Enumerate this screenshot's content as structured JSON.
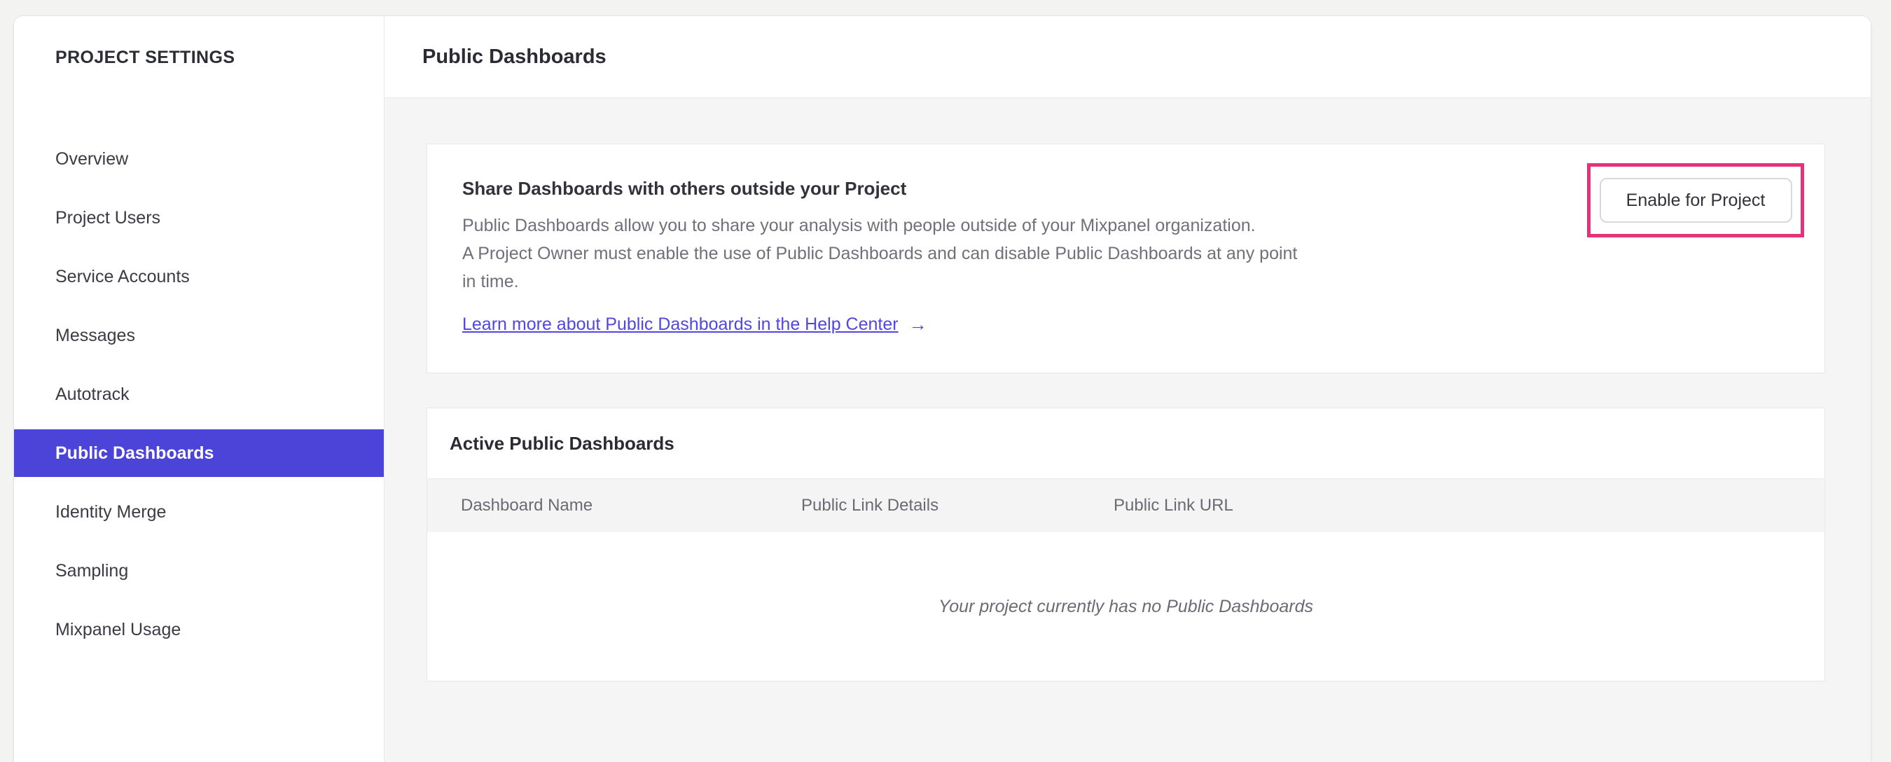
{
  "sidebar": {
    "title": "PROJECT SETTINGS",
    "items": [
      {
        "label": "Overview",
        "selected": false
      },
      {
        "label": "Project Users",
        "selected": false
      },
      {
        "label": "Service Accounts",
        "selected": false
      },
      {
        "label": "Messages",
        "selected": false
      },
      {
        "label": "Autotrack",
        "selected": false
      },
      {
        "label": "Public Dashboards",
        "selected": true
      },
      {
        "label": "Identity Merge",
        "selected": false
      },
      {
        "label": "Sampling",
        "selected": false
      },
      {
        "label": "Mixpanel Usage",
        "selected": false
      }
    ]
  },
  "header": {
    "title": "Public Dashboards"
  },
  "share_card": {
    "heading": "Share Dashboards with others outside your Project",
    "body_lines": [
      "Public Dashboards allow you to share your analysis with people outside of your Mixpanel organization.",
      "A Project Owner must enable the use of Public Dashboards and can disable Public Dashboards at any point",
      "in time."
    ],
    "link_label": "Learn more about Public Dashboards in the Help Center",
    "link_arrow": "→",
    "enable_button_label": "Enable for Project"
  },
  "active_card": {
    "heading": "Active Public Dashboards",
    "columns": [
      "Dashboard Name",
      "Public Link Details",
      "Public Link URL"
    ],
    "empty_message": "Your project currently has no Public Dashboards"
  },
  "colors": {
    "accent_purple": "#4c44d9",
    "highlight_pink": "#e63278",
    "link_indigo": "#5246e0"
  }
}
